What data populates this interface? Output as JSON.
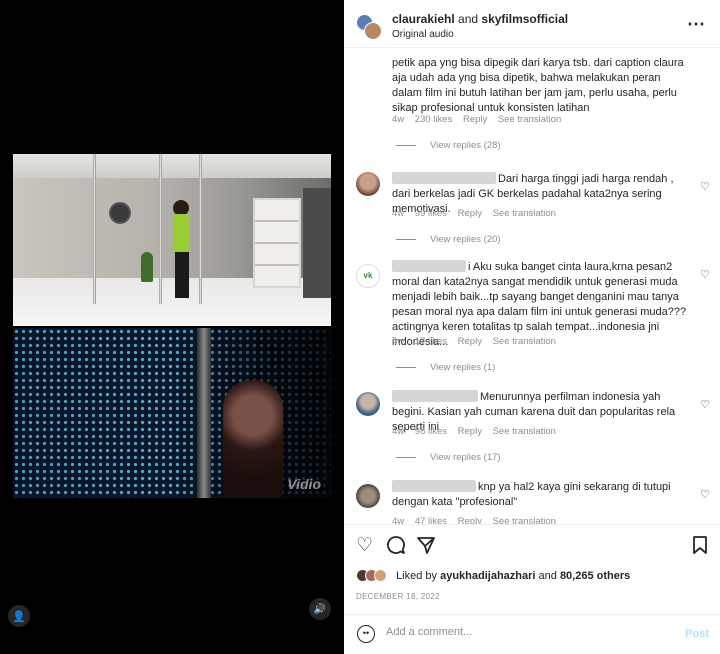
{
  "header": {
    "user1": "claurakiehl",
    "connector": " and ",
    "user2": "skyfilmsofficial",
    "audio": "Original audio",
    "more_icon": "more-options-icon"
  },
  "comments": [
    {
      "text": "petik apa yng bisa dipegik dari karya tsb. dari caption claura aja udah ada yng bisa dipetik, bahwa melakukan peran dalam film ini butuh latihan ber jam jam, perlu usaha, perlu sikap profesional untuk konsisten latihan",
      "age": "4w",
      "likes": "230 likes",
      "reply": "Reply",
      "translate": "See translation",
      "view_replies": "View replies (28)"
    },
    {
      "text": "Dari harga tinggi jadi harga rendah , dari berkelas jadi GK berkelas padahal kata2nya sering memotivasi.",
      "age": "4w",
      "likes": "99 likes",
      "reply": "Reply",
      "translate": "See translation",
      "view_replies": "View replies (20)"
    },
    {
      "text": "i Aku suka banget cinta laura,krna pesan2 moral dan kata2nya sangat mendidik untuk generasi muda menjadi lebih baik...tp sayang banget denganini mau tanya pesan moral nya apa dalam film ini untuk generasi muda???actingnya keren totalitas tp salah tempat...indonesia jni indonesia...",
      "age": "4w",
      "likes": "17 likes",
      "reply": "Reply",
      "translate": "See translation",
      "view_replies": "View replies (1)"
    },
    {
      "text": "Menurunnya perfilman indonesia yah begini. Kasian yah cuman karena duit dan popularitas rela seperti ini",
      "age": "4w",
      "likes": "98 likes",
      "reply": "Reply",
      "translate": "See translation",
      "view_replies": "View replies (17)"
    },
    {
      "text": "knp ya hal2 kaya gini sekarang di tutupi dengan kata \"profesional\"",
      "age": "4w",
      "likes": "47 likes",
      "reply": "Reply",
      "translate": "See translation"
    }
  ],
  "likes": {
    "prefix": "Liked by ",
    "user": "ayukhadijahazhari",
    "middle": " and ",
    "count": "80,265 others"
  },
  "date": "DECEMBER 18, 2022",
  "add_comment": {
    "placeholder": "Add a comment...",
    "post": "Post"
  },
  "media": {
    "watermark": "Vidio"
  },
  "colors": {
    "link_disabled": "#b2dffc",
    "meta": "#8e8e8e",
    "text": "#262626"
  }
}
